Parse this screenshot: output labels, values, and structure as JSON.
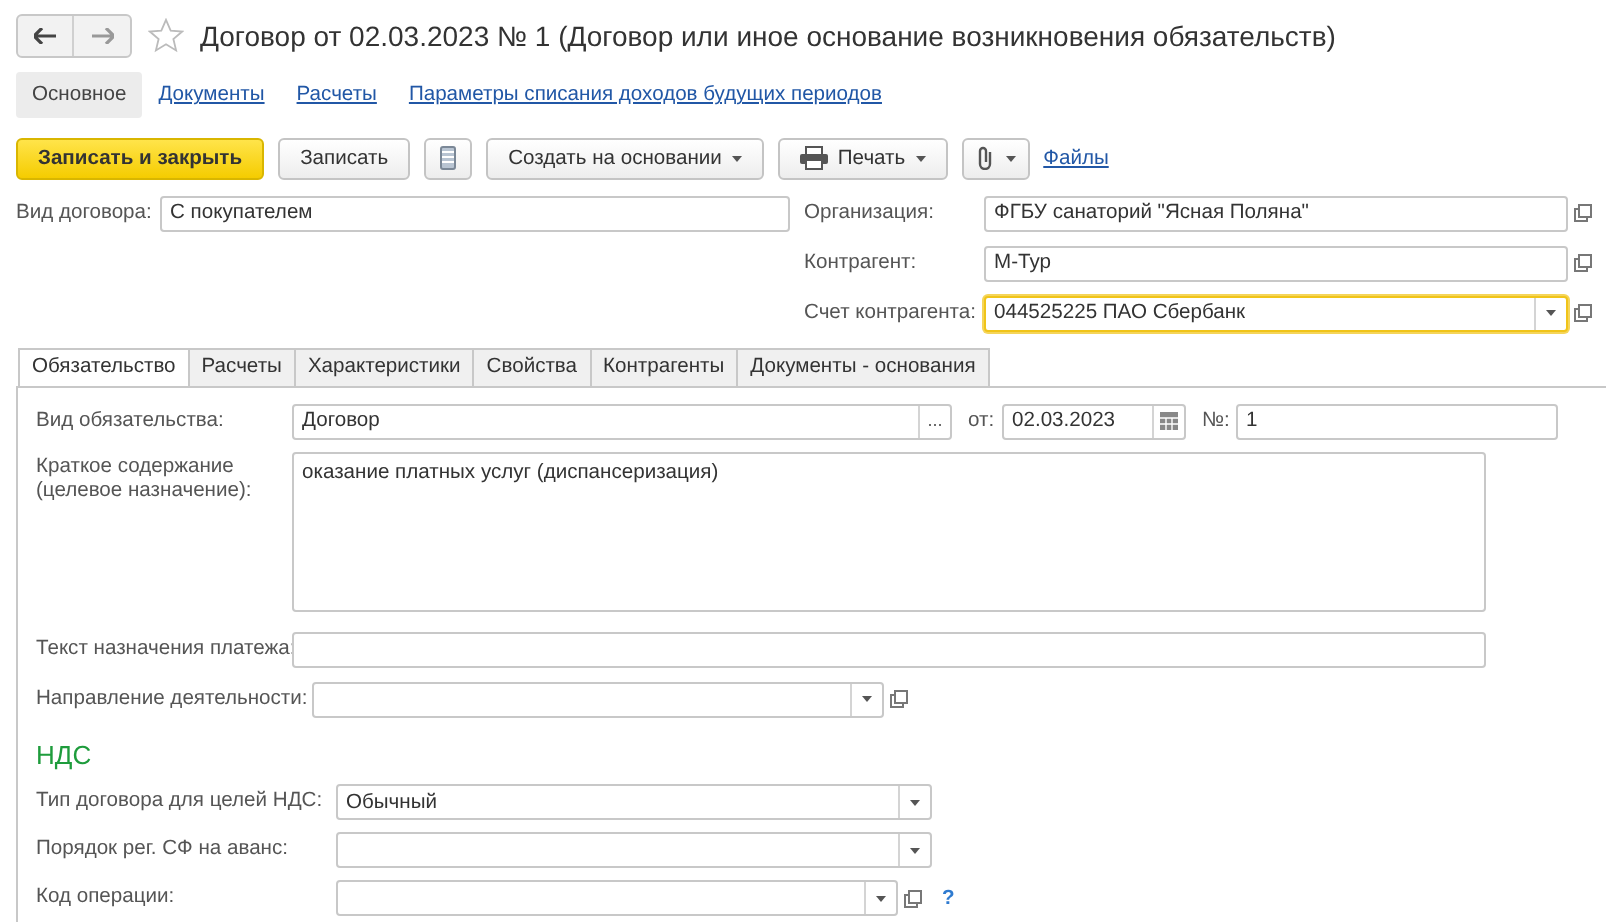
{
  "window": {
    "title": "Договор от 02.03.2023 № 1 (Договор или иное основание возникновения обязательств)",
    "favorite": false
  },
  "nav": [
    {
      "label": "Основное",
      "selected": true
    },
    {
      "label": "Документы",
      "selected": false
    },
    {
      "label": "Расчеты",
      "selected": false
    },
    {
      "label": "Параметры списания доходов будущих периодов",
      "selected": false
    }
  ],
  "toolbar": [
    {
      "kind": "primary",
      "label": "Записать и закрыть"
    },
    {
      "kind": "plain",
      "label": "Записать"
    },
    {
      "kind": "list"
    },
    {
      "kind": "menu",
      "label": "Создать на основании"
    },
    {
      "kind": "print",
      "label": "Печать"
    },
    {
      "kind": "attach"
    },
    {
      "kind": "link",
      "label": "Файлы"
    }
  ],
  "contract_type": {
    "label": "Вид договора:",
    "value": "С покупателем"
  },
  "parties": [
    {
      "label": "Организация:",
      "value": "ФГБУ санаторий \"Ясная Поляна\"",
      "focused": false,
      "open": true
    },
    {
      "label": "Контрагент:",
      "value": "М-Тур",
      "focused": false,
      "open": true
    },
    {
      "label": "Счет контрагента:",
      "value": "044525225 ПАО Сбербанк",
      "focused": true,
      "dropdown": true,
      "open": true
    }
  ],
  "tabs": [
    {
      "label": "Обязательство",
      "selected": true
    },
    {
      "label": "Расчеты",
      "selected": false
    },
    {
      "label": "Характеристики",
      "selected": false
    },
    {
      "label": "Свойства",
      "selected": false
    },
    {
      "label": "Контрагенты",
      "selected": false
    },
    {
      "label": "Документы - основания",
      "selected": false
    }
  ],
  "obligation": {
    "label": "Вид обязательства:",
    "value": "Договор",
    "select_mark": "...",
    "date_label": "от:",
    "date": "02.03.2023",
    "number_label": "№:",
    "number": "1"
  },
  "summary": {
    "label": "Краткое содержание (целевое назначение):",
    "value": "оказание платных услуг (диспансеризация)"
  },
  "payment_text": {
    "label": "Текст назначения платежа:"
  },
  "direction": {
    "label": "Направление деятельности:",
    "dropdown": true,
    "open": true
  },
  "vat": {
    "heading": "НДС",
    "fields": [
      {
        "label": "Тип договора для целей НДС:",
        "value": "Обычный",
        "dropdown": true
      },
      {
        "label": "Порядок рег. СФ на аванс:",
        "dropdown": true
      },
      {
        "label": "Код операции:",
        "dropdown": true,
        "open": true,
        "help_mark": "?"
      }
    ]
  }
}
